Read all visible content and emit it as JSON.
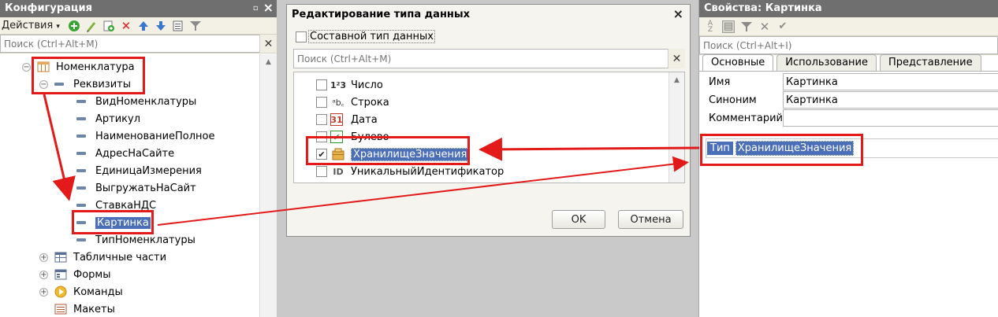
{
  "left_panel": {
    "title": "Конфигурация",
    "actions_label": "Действия",
    "actions_caret": "▾",
    "search_placeholder": "Поиск (Ctrl+Alt+M)",
    "tree": {
      "root": "Номенклатура",
      "attributes_group": "Реквизиты",
      "attributes": [
        "ВидНоменклатуры",
        "Артикул",
        "НаименованиеПолное",
        "АдресНаСайте",
        "ЕдиницаИзмерения",
        "ВыгружатьНаСайт",
        "СтавкаНДС",
        "Картинка",
        "ТипНоменклатуры"
      ],
      "selected_attribute": "Картинка",
      "groups": [
        "Табличные части",
        "Формы",
        "Команды",
        "Макеты"
      ]
    }
  },
  "dialog": {
    "title": "Редактирование типа данных",
    "compound_label": "Составной тип данных",
    "compound_checked": false,
    "search_placeholder": "Поиск (Ctrl+Alt+M)",
    "types": [
      {
        "label": "Число",
        "icon": "number-icon",
        "glyph": "1²3",
        "checked": false
      },
      {
        "label": "Строка",
        "icon": "string-icon",
        "glyph": "ᵃb꜀",
        "checked": false
      },
      {
        "label": "Дата",
        "icon": "calendar-icon",
        "glyph": "31",
        "checked": false
      },
      {
        "label": "Булево",
        "icon": "boolean-icon",
        "glyph": "✔",
        "checked": false
      },
      {
        "label": "ХранилищеЗначения",
        "icon": "value-storage-icon",
        "glyph": "▦",
        "checked": true
      },
      {
        "label": "УникальныйИдентификатор",
        "icon": "uuid-icon",
        "glyph": "ID",
        "checked": false
      }
    ],
    "ok_label": "OK",
    "cancel_label": "Отмена"
  },
  "right_panel": {
    "title": "Свойства: Картинка",
    "search_placeholder": "Поиск (Ctrl+Alt+I)",
    "tabs": [
      "Основные",
      "Использование",
      "Представление"
    ],
    "active_tab": "Основные",
    "fields": [
      {
        "label": "Имя",
        "value": "Картинка"
      },
      {
        "label": "Синоним",
        "value": "Картинка"
      },
      {
        "label": "Комментарий",
        "value": ""
      }
    ],
    "type_label": "Тип",
    "type_value": "ХранилищеЗначения"
  },
  "colors": {
    "selection": "#4b6fb7",
    "highlight": "#e21a1a",
    "titlebar": "#6f6f6f"
  }
}
